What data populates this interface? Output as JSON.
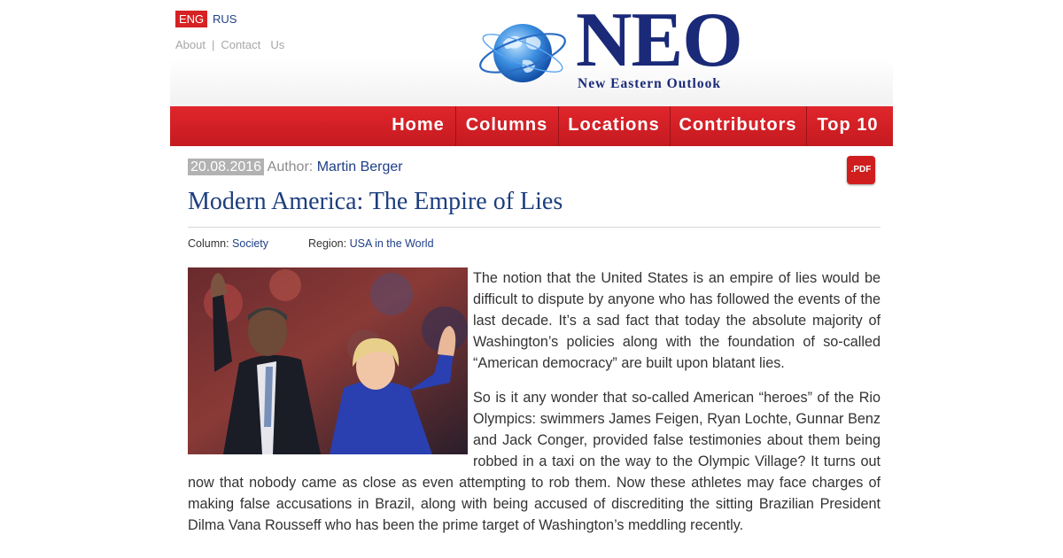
{
  "header": {
    "lang_eng": "ENG",
    "lang_rus": "RUS",
    "about": "About",
    "separator": "|",
    "contact": "Contact  Us",
    "logo_name": "NEO",
    "logo_subtitle": "New Eastern Outlook",
    "logo_icon": "globe-icon"
  },
  "nav": {
    "items": [
      "Home",
      "Columns",
      "Locations",
      "Contributors",
      "Top 10"
    ]
  },
  "article": {
    "date": "20.08.2016",
    "author_label": "Author:",
    "author_name": "Martin Berger",
    "pdf_label": ".PDF",
    "title": "Modern America: The Empire of Lies",
    "column_label": "Column:",
    "column_value": "Society",
    "region_label": "Region:",
    "region_value": "USA in the World",
    "paragraphs": [
      "The notion that the United States is an empire of lies would be difficult to dispute by anyone who has followed the events of the last decade. It’s a sad fact that today the absolute majority of Washington’s policies along with the foundation of so-called “American democracy” are built upon blatant lies.",
      "So is it any wonder that so-called American “heroes” of the Rio Olympics: swimmers James Feigen, Ryan Lochte, Gunnar Benz and Jack Conger, provided false testimonies about them being robbed in a taxi on the way to the Olympic Village? It turns out now that nobody came as close as even attempting to rob them. Now these athletes may face charges of making false accusations in Brazil, along with being accused of discrediting the sitting Brazilian President Dilma Vana Rousseff who has been the prime target of Washington’s meddling recently."
    ]
  },
  "colors": {
    "nav_red": "#d52224",
    "brand_blue": "#1a2a79",
    "link_blue": "#1f3f86"
  }
}
